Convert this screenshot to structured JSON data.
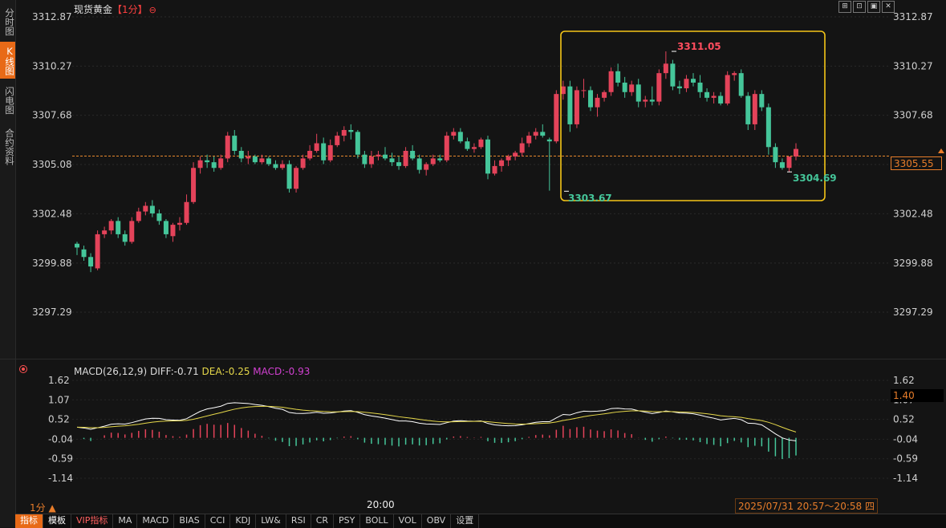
{
  "sidebar": {
    "items": [
      "分时图",
      "K线图",
      "闪电图",
      "合约资料"
    ],
    "active": "K线图"
  },
  "title": {
    "name": "现货黄金",
    "period": "【1分】",
    "settings_icon": "gear-icon"
  },
  "window_controls": [
    "layout-icon",
    "expand-icon",
    "image-icon",
    "close-icon"
  ],
  "price_axis": {
    "left_labels": [
      "3312.87",
      "3310.27",
      "3307.68",
      "3305.08",
      "3302.48",
      "3299.88",
      "3297.29"
    ],
    "right_labels": [
      "3312.87",
      "3310.27",
      "3307.68",
      "3305.08",
      "3302.48",
      "3299.88",
      "3297.29"
    ],
    "current_price": "3305.55"
  },
  "annotations": {
    "high": "3311.05",
    "low": "3303.67",
    "last_low": "3304.69"
  },
  "macd": {
    "label": "MACD(26,12,9)",
    "diff": "DIFF:-0.71",
    "dea": "DEA:-0.25",
    "macd": "MACD:-0.93",
    "axis_labels": [
      "1.62",
      "1.07",
      "0.52",
      "-0.04",
      "-0.59",
      "-1.14"
    ],
    "cursor_value": "1.40"
  },
  "footer": {
    "period": "1分 ▲",
    "time_tick": "20:00",
    "range": "2025/07/31 20:57～20:58 四"
  },
  "tabs": [
    "指标",
    "模板",
    "VIP指标",
    "MA",
    "MACD",
    "BIAS",
    "CCI",
    "KDJ",
    "LW&",
    "RSI",
    "CR",
    "PSY",
    "BOLL",
    "VOL",
    "OBV",
    "设置"
  ],
  "colors": {
    "up": "#e4435a",
    "down": "#45c69a",
    "accent": "#e86a17",
    "highlight_box": "#f5c518",
    "dea": "#e6d84a",
    "macd": "#d040d0"
  },
  "chart_data": {
    "type": "candlestick",
    "price_range": [
      3296.5,
      3313.5
    ],
    "candles": [
      [
        3300.9,
        3301.0,
        3300.3,
        3300.7
      ],
      [
        3300.6,
        3300.8,
        3300.0,
        3300.2
      ],
      [
        3300.2,
        3300.4,
        3299.4,
        3299.7
      ],
      [
        3299.6,
        3301.6,
        3299.5,
        3301.4
      ],
      [
        3301.4,
        3301.8,
        3301.2,
        3301.6
      ],
      [
        3301.6,
        3302.2,
        3301.4,
        3302.1
      ],
      [
        3302.1,
        3302.3,
        3301.2,
        3301.4
      ],
      [
        3301.4,
        3301.6,
        3300.8,
        3301.0
      ],
      [
        3301.0,
        3302.3,
        3300.9,
        3302.1
      ],
      [
        3302.1,
        3302.8,
        3302.0,
        3302.6
      ],
      [
        3302.6,
        3303.1,
        3302.4,
        3302.9
      ],
      [
        3302.9,
        3303.2,
        3302.3,
        3302.5
      ],
      [
        3302.5,
        3302.7,
        3301.9,
        3302.1
      ],
      [
        3302.1,
        3302.2,
        3301.2,
        3301.4
      ],
      [
        3301.3,
        3302.0,
        3301.0,
        3301.9
      ],
      [
        3301.9,
        3302.3,
        3301.6,
        3302.0
      ],
      [
        3302.0,
        3303.5,
        3301.9,
        3303.1
      ],
      [
        3303.1,
        3305.2,
        3303.0,
        3304.9
      ],
      [
        3304.9,
        3305.5,
        3304.6,
        3305.3
      ],
      [
        3305.3,
        3305.6,
        3304.9,
        3305.2
      ],
      [
        3305.2,
        3305.5,
        3304.7,
        3304.9
      ],
      [
        3304.9,
        3305.6,
        3304.8,
        3305.4
      ],
      [
        3305.4,
        3306.8,
        3305.2,
        3306.6
      ],
      [
        3306.6,
        3306.9,
        3305.6,
        3305.8
      ],
      [
        3305.8,
        3306.0,
        3305.2,
        3305.4
      ],
      [
        3305.4,
        3305.8,
        3305.1,
        3305.5
      ],
      [
        3305.5,
        3305.6,
        3305.1,
        3305.2
      ],
      [
        3305.2,
        3305.6,
        3305.1,
        3305.4
      ],
      [
        3305.4,
        3305.5,
        3305.0,
        3305.1
      ],
      [
        3305.1,
        3305.3,
        3304.8,
        3304.9
      ],
      [
        3304.9,
        3305.3,
        3304.8,
        3305.1
      ],
      [
        3305.1,
        3305.3,
        3303.6,
        3303.8
      ],
      [
        3303.8,
        3305.0,
        3303.6,
        3304.9
      ],
      [
        3304.9,
        3305.6,
        3304.8,
        3305.4
      ],
      [
        3305.4,
        3306.1,
        3305.3,
        3305.8
      ],
      [
        3305.8,
        3306.7,
        3305.7,
        3306.2
      ],
      [
        3306.2,
        3306.5,
        3305.1,
        3305.3
      ],
      [
        3305.3,
        3306.4,
        3305.2,
        3306.1
      ],
      [
        3306.1,
        3306.8,
        3306.0,
        3306.6
      ],
      [
        3306.6,
        3307.1,
        3306.3,
        3306.9
      ],
      [
        3306.9,
        3307.2,
        3306.4,
        3306.8
      ],
      [
        3306.8,
        3306.9,
        3305.4,
        3305.6
      ],
      [
        3305.6,
        3305.8,
        3304.9,
        3305.1
      ],
      [
        3305.1,
        3305.8,
        3304.9,
        3305.5
      ],
      [
        3305.5,
        3305.8,
        3305.3,
        3305.6
      ],
      [
        3305.6,
        3306.0,
        3305.3,
        3305.4
      ],
      [
        3305.4,
        3305.7,
        3305.0,
        3305.2
      ],
      [
        3305.2,
        3305.5,
        3304.8,
        3305.0
      ],
      [
        3305.0,
        3306.0,
        3304.9,
        3305.8
      ],
      [
        3305.8,
        3306.1,
        3305.3,
        3305.4
      ],
      [
        3305.4,
        3305.6,
        3304.6,
        3304.8
      ],
      [
        3304.8,
        3305.2,
        3304.5,
        3305.1
      ],
      [
        3305.1,
        3305.6,
        3305.0,
        3305.4
      ],
      [
        3305.4,
        3305.6,
        3305.2,
        3305.3
      ],
      [
        3305.3,
        3306.8,
        3305.2,
        3306.6
      ],
      [
        3306.6,
        3307.0,
        3306.4,
        3306.8
      ],
      [
        3306.8,
        3307.0,
        3306.2,
        3306.3
      ],
      [
        3306.3,
        3306.5,
        3305.8,
        3305.9
      ],
      [
        3305.9,
        3306.2,
        3305.7,
        3306.0
      ],
      [
        3306.0,
        3306.5,
        3305.9,
        3306.4
      ],
      [
        3306.4,
        3306.6,
        3304.3,
        3304.6
      ],
      [
        3304.6,
        3305.3,
        3304.5,
        3305.0
      ],
      [
        3305.0,
        3305.4,
        3304.7,
        3305.3
      ],
      [
        3305.3,
        3305.6,
        3305.0,
        3305.5
      ],
      [
        3305.5,
        3305.8,
        3305.3,
        3305.7
      ],
      [
        3305.7,
        3306.5,
        3305.5,
        3306.2
      ],
      [
        3306.2,
        3306.8,
        3306.0,
        3306.6
      ],
      [
        3306.6,
        3307.0,
        3306.4,
        3306.8
      ],
      [
        3306.8,
        3307.2,
        3306.5,
        3306.6
      ],
      [
        3306.4,
        3306.5,
        3303.7,
        3306.3
      ],
      [
        3306.3,
        3309.0,
        3306.2,
        3308.8
      ],
      [
        3308.8,
        3309.5,
        3308.5,
        3309.2
      ],
      [
        3309.2,
        3309.5,
        3306.8,
        3307.2
      ],
      [
        3307.2,
        3309.2,
        3307.0,
        3309.0
      ],
      [
        3309.0,
        3309.6,
        3308.6,
        3309.0
      ],
      [
        3309.0,
        3309.2,
        3307.9,
        3308.1
      ],
      [
        3308.1,
        3308.8,
        3307.6,
        3308.6
      ],
      [
        3308.6,
        3309.0,
        3308.4,
        3308.9
      ],
      [
        3308.9,
        3310.2,
        3308.7,
        3310.0
      ],
      [
        3310.0,
        3310.4,
        3309.2,
        3309.4
      ],
      [
        3309.4,
        3309.7,
        3308.6,
        3308.9
      ],
      [
        3308.9,
        3309.5,
        3308.7,
        3309.3
      ],
      [
        3309.3,
        3309.6,
        3308.1,
        3308.4
      ],
      [
        3308.4,
        3308.7,
        3308.1,
        3308.5
      ],
      [
        3308.5,
        3309.2,
        3308.2,
        3308.4
      ],
      [
        3308.4,
        3310.1,
        3308.2,
        3309.9
      ],
      [
        3309.9,
        3311.05,
        3309.6,
        3310.4
      ],
      [
        3310.4,
        3310.6,
        3309.0,
        3309.2
      ],
      [
        3309.2,
        3309.5,
        3308.8,
        3309.1
      ],
      [
        3309.1,
        3309.8,
        3308.9,
        3309.6
      ],
      [
        3309.6,
        3309.9,
        3309.2,
        3309.4
      ],
      [
        3309.4,
        3309.8,
        3308.6,
        3308.9
      ],
      [
        3308.9,
        3309.1,
        3308.4,
        3308.6
      ],
      [
        3308.6,
        3308.9,
        3308.3,
        3308.7
      ],
      [
        3308.7,
        3308.9,
        3308.2,
        3308.3
      ],
      [
        3308.3,
        3310.0,
        3308.2,
        3309.8
      ],
      [
        3309.8,
        3310.0,
        3309.5,
        3309.9
      ],
      [
        3309.9,
        3310.1,
        3308.6,
        3308.7
      ],
      [
        3308.7,
        3308.9,
        3306.9,
        3307.2
      ],
      [
        3307.2,
        3309.0,
        3306.9,
        3308.8
      ],
      [
        3308.8,
        3309.0,
        3307.9,
        3308.1
      ],
      [
        3308.1,
        3308.3,
        3305.6,
        3306.0
      ],
      [
        3306.0,
        3306.2,
        3304.9,
        3305.2
      ],
      [
        3305.2,
        3305.4,
        3304.8,
        3304.9
      ],
      [
        3304.9,
        3305.3,
        3304.69,
        3305.5
      ],
      [
        3305.5,
        3306.2,
        3305.3,
        3305.9
      ]
    ]
  }
}
